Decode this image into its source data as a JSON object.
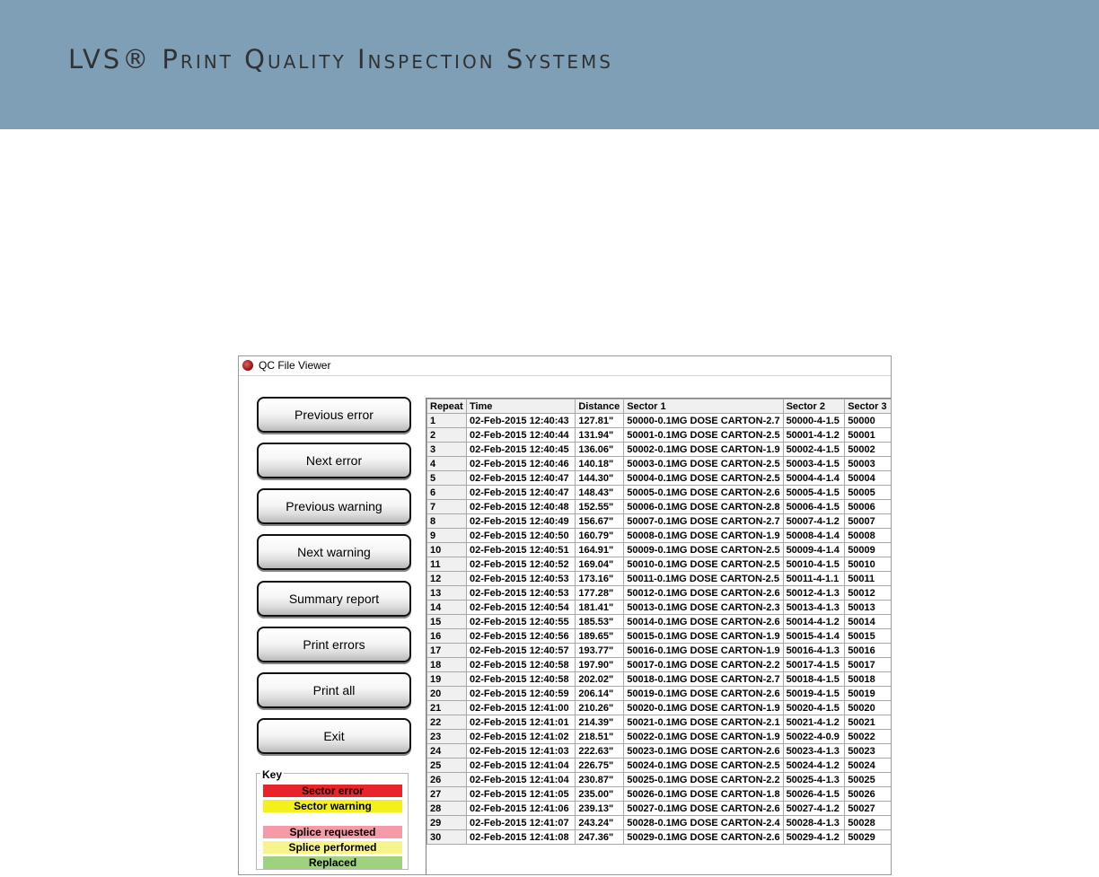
{
  "banner": {
    "title": "LVS® Print Quality Inspection Systems"
  },
  "window": {
    "title": "QC File Viewer",
    "icon": "app-logo-icon"
  },
  "buttons": {
    "previous_error": "Previous error",
    "next_error": "Next error",
    "previous_warning": "Previous warning",
    "next_warning": "Next warning",
    "summary_report": "Summary report",
    "print_errors": "Print errors",
    "print_all": "Print all",
    "exit": "Exit"
  },
  "key": {
    "legend": "Key",
    "items": [
      {
        "label": "Sector error",
        "color": "#e8232a"
      },
      {
        "label": "Sector warning",
        "color": "#f4f01c"
      },
      {
        "label": "Splice requested",
        "color": "#f59aa6"
      },
      {
        "label": "Splice performed",
        "color": "#f6f48a"
      },
      {
        "label": "Replaced",
        "color": "#9ed27e"
      }
    ]
  },
  "table": {
    "headers": [
      "Repeat",
      "Time",
      "Distance",
      "Sector 1",
      "Sector 2",
      "Sector 3"
    ],
    "rows": [
      [
        "1",
        "02-Feb-2015 12:40:43",
        "127.81\"",
        "50000-0.1MG DOSE CARTON-2.7",
        "50000-4-1.5",
        "50000"
      ],
      [
        "2",
        "02-Feb-2015 12:40:44",
        "131.94\"",
        "50001-0.1MG DOSE CARTON-2.5",
        "50001-4-1.2",
        "50001"
      ],
      [
        "3",
        "02-Feb-2015 12:40:45",
        "136.06\"",
        "50002-0.1MG DOSE CARTON-1.9",
        "50002-4-1.5",
        "50002"
      ],
      [
        "4",
        "02-Feb-2015 12:40:46",
        "140.18\"",
        "50003-0.1MG DOSE CARTON-2.5",
        "50003-4-1.5",
        "50003"
      ],
      [
        "5",
        "02-Feb-2015 12:40:47",
        "144.30\"",
        "50004-0.1MG DOSE CARTON-2.5",
        "50004-4-1.4",
        "50004"
      ],
      [
        "6",
        "02-Feb-2015 12:40:47",
        "148.43\"",
        "50005-0.1MG DOSE CARTON-2.6",
        "50005-4-1.5",
        "50005"
      ],
      [
        "7",
        "02-Feb-2015 12:40:48",
        "152.55\"",
        "50006-0.1MG DOSE CARTON-2.8",
        "50006-4-1.5",
        "50006"
      ],
      [
        "8",
        "02-Feb-2015 12:40:49",
        "156.67\"",
        "50007-0.1MG DOSE CARTON-2.7",
        "50007-4-1.2",
        "50007"
      ],
      [
        "9",
        "02-Feb-2015 12:40:50",
        "160.79\"",
        "50008-0.1MG DOSE CARTON-1.9",
        "50008-4-1.4",
        "50008"
      ],
      [
        "10",
        "02-Feb-2015 12:40:51",
        "164.91\"",
        "50009-0.1MG DOSE CARTON-2.5",
        "50009-4-1.4",
        "50009"
      ],
      [
        "11",
        "02-Feb-2015 12:40:52",
        "169.04\"",
        "50010-0.1MG DOSE CARTON-2.5",
        "50010-4-1.5",
        "50010"
      ],
      [
        "12",
        "02-Feb-2015 12:40:53",
        "173.16\"",
        "50011-0.1MG DOSE CARTON-2.5",
        "50011-4-1.1",
        "50011"
      ],
      [
        "13",
        "02-Feb-2015 12:40:53",
        "177.28\"",
        "50012-0.1MG DOSE CARTON-2.6",
        "50012-4-1.3",
        "50012"
      ],
      [
        "14",
        "02-Feb-2015 12:40:54",
        "181.41\"",
        "50013-0.1MG DOSE CARTON-2.3",
        "50013-4-1.3",
        "50013"
      ],
      [
        "15",
        "02-Feb-2015 12:40:55",
        "185.53\"",
        "50014-0.1MG DOSE CARTON-2.6",
        "50014-4-1.2",
        "50014"
      ],
      [
        "16",
        "02-Feb-2015 12:40:56",
        "189.65\"",
        "50015-0.1MG DOSE CARTON-1.9",
        "50015-4-1.4",
        "50015"
      ],
      [
        "17",
        "02-Feb-2015 12:40:57",
        "193.77\"",
        "50016-0.1MG DOSE CARTON-1.9",
        "50016-4-1.3",
        "50016"
      ],
      [
        "18",
        "02-Feb-2015 12:40:58",
        "197.90\"",
        "50017-0.1MG DOSE CARTON-2.2",
        "50017-4-1.5",
        "50017"
      ],
      [
        "19",
        "02-Feb-2015 12:40:58",
        "202.02\"",
        "50018-0.1MG DOSE CARTON-2.7",
        "50018-4-1.5",
        "50018"
      ],
      [
        "20",
        "02-Feb-2015 12:40:59",
        "206.14\"",
        "50019-0.1MG DOSE CARTON-2.6",
        "50019-4-1.5",
        "50019"
      ],
      [
        "21",
        "02-Feb-2015 12:41:00",
        "210.26\"",
        "50020-0.1MG DOSE CARTON-1.9",
        "50020-4-1.5",
        "50020"
      ],
      [
        "22",
        "02-Feb-2015 12:41:01",
        "214.39\"",
        "50021-0.1MG DOSE CARTON-2.1",
        "50021-4-1.2",
        "50021"
      ],
      [
        "23",
        "02-Feb-2015 12:41:02",
        "218.51\"",
        "50022-0.1MG DOSE CARTON-1.9",
        "50022-4-0.9",
        "50022"
      ],
      [
        "24",
        "02-Feb-2015 12:41:03",
        "222.63\"",
        "50023-0.1MG DOSE CARTON-2.6",
        "50023-4-1.3",
        "50023"
      ],
      [
        "25",
        "02-Feb-2015 12:41:04",
        "226.75\"",
        "50024-0.1MG DOSE CARTON-2.5",
        "50024-4-1.2",
        "50024"
      ],
      [
        "26",
        "02-Feb-2015 12:41:04",
        "230.87\"",
        "50025-0.1MG DOSE CARTON-2.2",
        "50025-4-1.3",
        "50025"
      ],
      [
        "27",
        "02-Feb-2015 12:41:05",
        "235.00\"",
        "50026-0.1MG DOSE CARTON-1.8",
        "50026-4-1.5",
        "50026"
      ],
      [
        "28",
        "02-Feb-2015 12:41:06",
        "239.13\"",
        "50027-0.1MG DOSE CARTON-2.6",
        "50027-4-1.2",
        "50027"
      ],
      [
        "29",
        "02-Feb-2015 12:41:07",
        "243.24\"",
        "50028-0.1MG DOSE CARTON-2.4",
        "50028-4-1.3",
        "50028"
      ],
      [
        "30",
        "02-Feb-2015 12:41:08",
        "247.36\"",
        "50029-0.1MG DOSE CARTON-2.6",
        "50029-4-1.2",
        "50029"
      ]
    ]
  }
}
